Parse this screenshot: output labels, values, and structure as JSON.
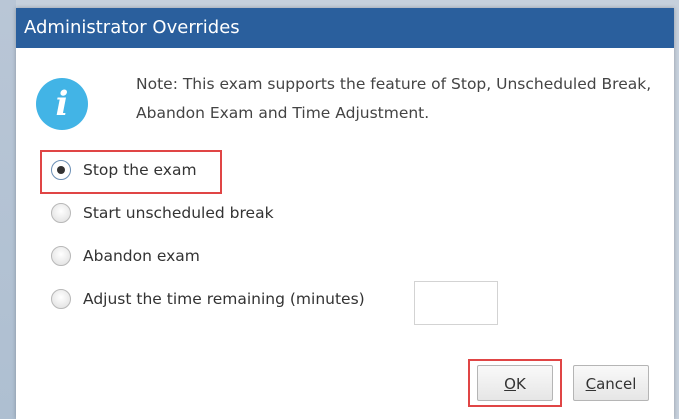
{
  "dialog": {
    "title": "Administrator Overrides",
    "note": "Note: This exam supports the feature of Stop, Unscheduled Break, Abandon Exam and Time Adjustment.",
    "options": [
      {
        "label": "Stop the exam",
        "selected": true
      },
      {
        "label": "Start unscheduled break",
        "selected": false
      },
      {
        "label": "Abandon exam",
        "selected": false
      },
      {
        "label": "Adjust the time remaining (minutes)",
        "selected": false
      }
    ],
    "time_remaining_value": "",
    "buttons": {
      "ok_first": "O",
      "ok_rest": "K",
      "cancel_first": "C",
      "cancel_rest": "ancel"
    }
  },
  "icons": {
    "info": "info-icon"
  },
  "colors": {
    "titlebar": "#2a5f9d",
    "highlight": "#e04545",
    "info_icon": "#42b4e6"
  }
}
